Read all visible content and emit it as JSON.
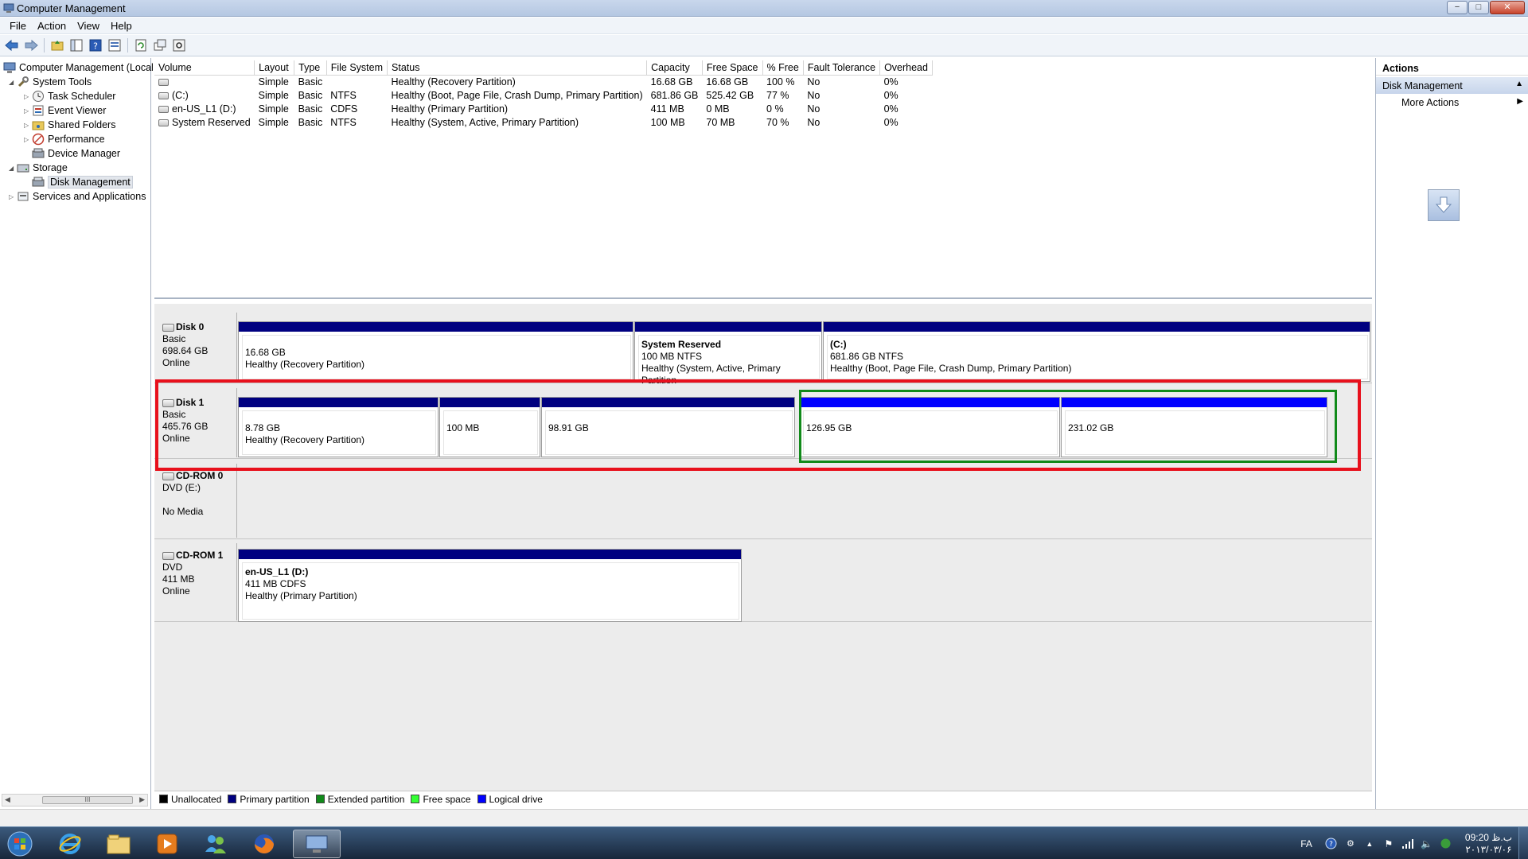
{
  "window": {
    "title": "Computer Management",
    "minimize": "−",
    "maximize": "□",
    "close": "✕"
  },
  "menu": [
    "File",
    "Action",
    "View",
    "Help"
  ],
  "toolbar_icons": [
    "back-icon",
    "forward-icon",
    "up-folder-icon",
    "show-hide-tree-icon",
    "help-icon",
    "properties-icon",
    "refresh-icon",
    "export-icon",
    "settings-icon"
  ],
  "tree": {
    "root": "Computer Management (Local",
    "system_tools": "System Tools",
    "task_scheduler": "Task Scheduler",
    "event_viewer": "Event Viewer",
    "shared_folders": "Shared Folders",
    "performance": "Performance",
    "device_manager": "Device Manager",
    "storage": "Storage",
    "disk_management": "Disk Management",
    "services": "Services and Applications",
    "scroll_thumb": "III"
  },
  "volume_table": {
    "columns": [
      "Volume",
      "Layout",
      "Type",
      "File System",
      "Status",
      "Capacity",
      "Free Space",
      "% Free",
      "Fault Tolerance",
      "Overhead"
    ],
    "rows": [
      [
        "",
        "Simple",
        "Basic",
        "",
        "Healthy (Recovery Partition)",
        "16.68 GB",
        "16.68 GB",
        "100 %",
        "No",
        "0%"
      ],
      [
        "(C:)",
        "Simple",
        "Basic",
        "NTFS",
        "Healthy (Boot, Page File, Crash Dump, Primary Partition)",
        "681.86 GB",
        "525.42 GB",
        "77 %",
        "No",
        "0%"
      ],
      [
        "en-US_L1 (D:)",
        "Simple",
        "Basic",
        "CDFS",
        "Healthy (Primary Partition)",
        "411 MB",
        "0 MB",
        "0 %",
        "No",
        "0%"
      ],
      [
        "System Reserved",
        "Simple",
        "Basic",
        "NTFS",
        "Healthy (System, Active, Primary Partition)",
        "100 MB",
        "70 MB",
        "70 %",
        "No",
        "0%"
      ]
    ]
  },
  "disks": {
    "disk0": {
      "name": "Disk 0",
      "type": "Basic",
      "size": "698.64 GB",
      "status": "Online",
      "parts": [
        {
          "title": "",
          "line1": "16.68 GB",
          "line2": "Healthy (Recovery Partition)"
        },
        {
          "title": "System Reserved",
          "line1": "100 MB NTFS",
          "line2": "Healthy (System, Active, Primary Partition"
        },
        {
          "title": "(C:)",
          "line1": "681.86 GB NTFS",
          "line2": "Healthy (Boot, Page File, Crash Dump, Primary Partition)"
        }
      ]
    },
    "disk1": {
      "name": "Disk 1",
      "type": "Basic",
      "size": "465.76 GB",
      "status": "Online",
      "parts": [
        {
          "line1": "8.78 GB",
          "line2": "Healthy (Recovery Partition)"
        },
        {
          "line1": "100 MB",
          "line2": ""
        },
        {
          "line1": "98.91 GB",
          "line2": ""
        },
        {
          "line1": "126.95 GB",
          "line2": ""
        },
        {
          "line1": "231.02 GB",
          "line2": ""
        }
      ]
    },
    "cdrom0": {
      "name": "CD-ROM 0",
      "type": "DVD (E:)",
      "size": "",
      "status": "No Media"
    },
    "cdrom1": {
      "name": "CD-ROM 1",
      "type": "DVD",
      "size": "411 MB",
      "status": "Online",
      "part": {
        "title": "en-US_L1  (D:)",
        "line1": "411 MB CDFS",
        "line2": "Healthy (Primary Partition)"
      }
    }
  },
  "legend": [
    {
      "label": "Unallocated",
      "color": "#000000"
    },
    {
      "label": "Primary partition",
      "color": "#000080"
    },
    {
      "label": "Extended partition",
      "color": "#118a1a"
    },
    {
      "label": "Free space",
      "color": "#33ff33"
    },
    {
      "label": "Logical drive",
      "color": "#0000ff"
    }
  ],
  "actions": {
    "title": "Actions",
    "section": "Disk Management",
    "more": "More Actions"
  },
  "taskbar": {
    "apps": [
      "start-orb-icon",
      "internet-explorer-icon",
      "windows-explorer-icon",
      "media-player-icon",
      "messenger-icon",
      "firefox-icon",
      "computer-management-icon"
    ],
    "lang": "FA",
    "time": "09:20 ب.ظ",
    "date": "۲۰۱۳/۰۳/۰۶"
  },
  "colors": {
    "primary_partition": "#000080",
    "logical_drive": "#0000ff",
    "highlight_red": "#e8101c",
    "highlight_green": "#118a1a"
  }
}
